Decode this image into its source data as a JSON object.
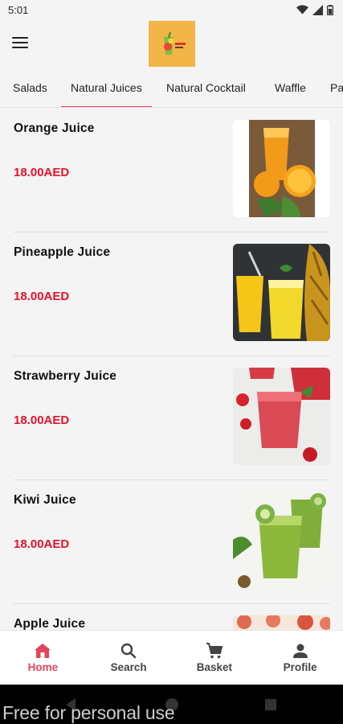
{
  "status_bar": {
    "time": "5:01",
    "icons": [
      "wifi-icon",
      "signal-icon",
      "battery-icon"
    ]
  },
  "header": {
    "menu_icon": "hamburger-icon",
    "logo_icon": "juice-logo-icon"
  },
  "tabs": [
    {
      "label": "Salads"
    },
    {
      "label": "Natural Juices",
      "active": true
    },
    {
      "label": "Natural Cocktail"
    },
    {
      "label": "Waffle"
    },
    {
      "label": "Pa"
    }
  ],
  "products": [
    {
      "name": "Orange Juice",
      "price": "18.00AED",
      "image": "orange-juice-image"
    },
    {
      "name": "Pineapple Juice",
      "price": "18.00AED",
      "image": "pineapple-juice-image"
    },
    {
      "name": "Strawberry Juice",
      "price": "18.00AED",
      "image": "strawberry-juice-image"
    },
    {
      "name": "Kiwi Juice",
      "price": "18.00AED",
      "image": "kiwi-juice-image"
    },
    {
      "name": "Apple Juice",
      "price": "",
      "image": "apple-juice-image"
    }
  ],
  "bottom_nav": [
    {
      "label": "Home",
      "icon": "home-icon",
      "active": true
    },
    {
      "label": "Search",
      "icon": "search-icon"
    },
    {
      "label": "Basket",
      "icon": "cart-icon"
    },
    {
      "label": "Profile",
      "icon": "person-icon"
    }
  ],
  "watermark": "Free for personal use",
  "colors": {
    "accent": "#e5455c",
    "price": "#e4122c",
    "logo_bg": "#f2b548"
  }
}
